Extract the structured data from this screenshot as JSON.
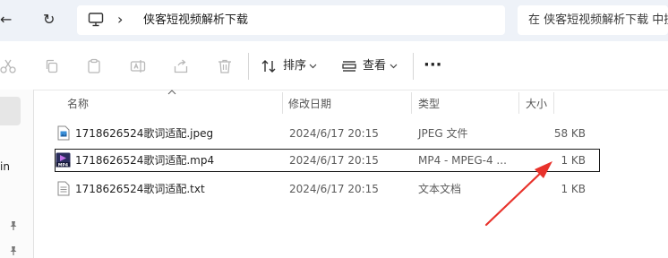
{
  "nav": {
    "back_glyph": "←",
    "refresh_glyph": "↻",
    "chevron": "›",
    "address_text": "侠客短视频解析下载",
    "search_placeholder": "在 侠客短视频解析下载 中搜索"
  },
  "toolbar": {
    "sort_label": "排序",
    "view_label": "查看",
    "more_label": "···"
  },
  "leftnav": {
    "fragment": "in"
  },
  "columns": {
    "name": "名称",
    "modified": "修改日期",
    "type": "类型",
    "size": "大小"
  },
  "files": [
    {
      "name": "1718626524歌词适配.jpeg",
      "modified": "2024/6/17 20:15",
      "type": "JPEG 文件",
      "size": "58 KB",
      "icon": "jpeg-file-icon"
    },
    {
      "name": "1718626524歌词适配.mp4",
      "modified": "2024/6/17 20:15",
      "type": "MP4 - MPEG-4 ...",
      "size": "1 KB",
      "icon": "mp4-file-icon",
      "selected": true
    },
    {
      "name": "1718626524歌词适配.txt",
      "modified": "2024/6/17 20:15",
      "type": "文本文档",
      "size": "1 KB",
      "icon": "txt-file-icon"
    }
  ],
  "colors": {
    "nav_bg": "#eef2f8",
    "annotation_arrow": "#e8322b",
    "selection_border": "#1a1a1a"
  }
}
